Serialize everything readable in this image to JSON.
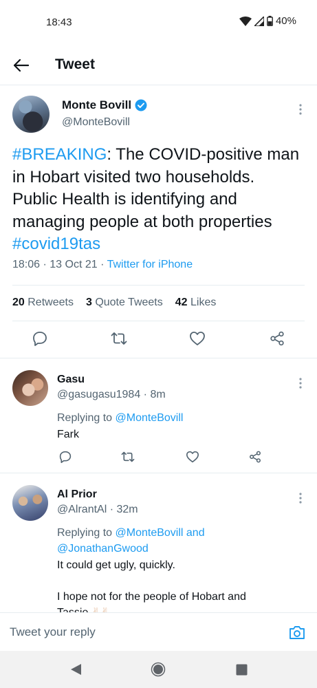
{
  "status_bar": {
    "time": "18:43",
    "battery": "40%"
  },
  "header": {
    "title": "Tweet"
  },
  "main_tweet": {
    "display_name": "Monte Bovill",
    "handle": "@MonteBovill",
    "text_hashtag_1": "#BREAKING",
    "text_body": ": The COVID-positive man in Hobart visited two households. Public Health is identifying and managing people at both properties ",
    "text_hashtag_2": "#covid19tas",
    "time": "18:06",
    "date": "13 Oct 21",
    "source": "Twitter for iPhone",
    "retweets_count": "20",
    "retweets_label": "Retweets",
    "quotes_count": "3",
    "quotes_label": "Quote Tweets",
    "likes_count": "42",
    "likes_label": "Likes"
  },
  "replies": [
    {
      "display_name": "Gasu",
      "handle": "@gasugasu1984",
      "age": "8m",
      "replying_prefix": "Replying to ",
      "replying_to": "@MonteBovill",
      "text": "Fark"
    },
    {
      "display_name": "Al Prior",
      "handle": "@AlrantAl",
      "age": "32m",
      "replying_prefix": "Replying to ",
      "replying_to_1": "@MonteBovill",
      "replying_join": " and",
      "replying_to_2": "@JonathanGwood",
      "text_line_1": "It could get ugly, quickly.",
      "text_line_2": "I hope not for the people of Hobart and",
      "text_line_3": "Tassie"
    }
  ],
  "compose": {
    "placeholder": "Tweet your reply"
  },
  "colors": {
    "accent": "#1d9bf0",
    "text": "#0f1419",
    "secondary": "#536471"
  }
}
